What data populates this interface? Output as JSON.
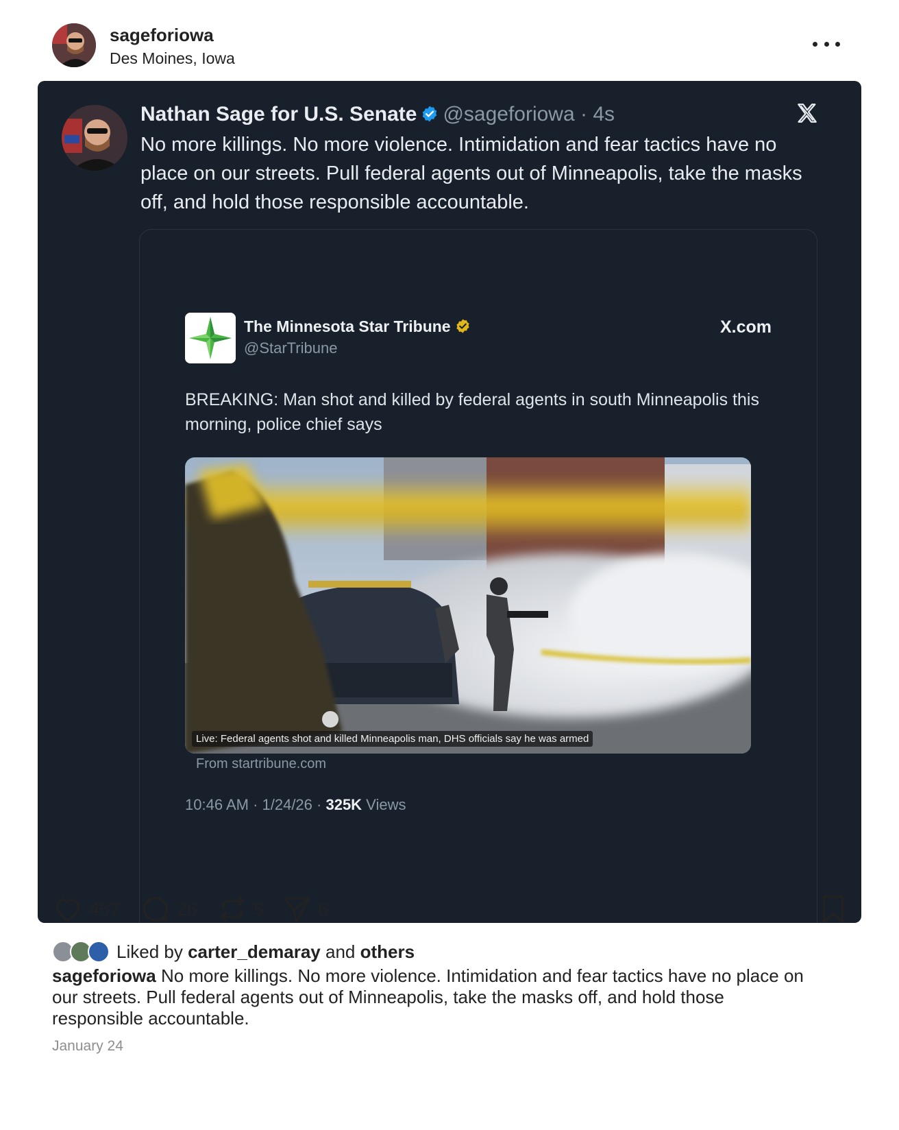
{
  "post": {
    "username": "sageforiowa",
    "location": "Des Moines, Iowa"
  },
  "tweet": {
    "display_name": "Nathan Sage for U.S. Senate",
    "handle_time": "@sageforiowa · 4s",
    "text": "No more killings. No more violence. Intimidation and fear tactics have no place on our streets. Pull federal agents out of Minneapolis, take the masks off, and hold those responsible accountable."
  },
  "embed": {
    "source_name": "The Minnesota Star Tribune",
    "source_handle": "@StarTribune",
    "site_label": "X.com",
    "text": "BREAKING: Man shot and killed by federal agents in south Minneapolis this morning, police chief says",
    "photo_caption": "Live: Federal agents shot and killed Minneapolis man, DHS officials say he was armed",
    "from_link": "From startribune.com",
    "timestamp": "10:46 AM · 1/24/26 · ",
    "views_count": "325K",
    "views_label": " Views"
  },
  "actions": {
    "likes": "457",
    "comments": "26",
    "reposts": "5",
    "shares": "6"
  },
  "liked_by": {
    "prefix": "Liked by ",
    "user": "carter_demaray",
    "middle": " and ",
    "others": "others"
  },
  "caption": {
    "username": "sageforiowa",
    "text": " No more killings. No more violence. Intimidation and fear tactics have no place on our streets. Pull federal agents out of Minneapolis, take the masks off, and hold those responsible accountable."
  },
  "date": "January 24",
  "colors": {
    "card_bg": "#17202b",
    "verified_blue": "#1d9bf0",
    "verified_gold": "#e2b719",
    "tape_yellow": "#e6c22a"
  }
}
